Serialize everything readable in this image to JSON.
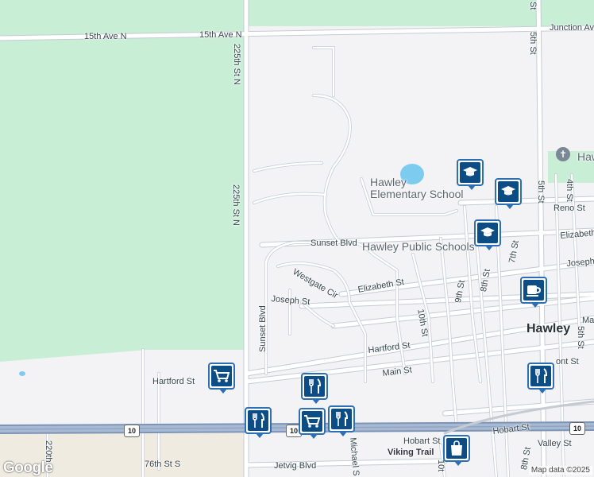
{
  "map": {
    "colors": {
      "park": "#c8eed6",
      "land": "#f3f3f5",
      "farm": "#f0ebe0",
      "road": "#ffffff",
      "road_edge": "#c5cbd3",
      "highway": "#8fa5c2",
      "water": "#7ecbf0"
    },
    "labels": {
      "ave15_west": "15th Ave N",
      "ave15_east": "15th Ave N",
      "st225_top": "225th St N",
      "st225_mid": "225th St N",
      "st5_top": "5th St",
      "junction": "Junction Ave",
      "hawley_church": "Hawl",
      "elementary": "Hawley Elementary School",
      "public_schools": "Hawley Public Schools",
      "sunset_blvd_h": "Sunset Blvd",
      "sunset_blvd_v": "Sunset Blvd",
      "westgate": "Westgate Cir",
      "elizabeth_w": "Elizabeth St",
      "elizabeth_e": "Elizabeth",
      "joseph_w": "Joseph St",
      "joseph_e": "Joseph",
      "reno": "Reno St",
      "st4": "4th St",
      "st5_mid": "5th St",
      "st5_low": "5th St",
      "st7": "7th St",
      "st8": "8th St",
      "st8_low": "8th St",
      "st9": "9th St",
      "st10": "10th St",
      "hawley": "Hawley",
      "ma": "Ma",
      "hartford_w": "Hartford St",
      "hartford_e": "Hartford St",
      "main": "Main St",
      "front": "ont St",
      "hobart_w": "Hobart St",
      "hobart_e": "Hobart St",
      "valley": "Valley St",
      "viking": "Viking Trail",
      "st76": "76th St S",
      "jetvig": "Jetvig Blvd",
      "michael": "Michael S",
      "st220": "220th",
      "st10_low": "10t",
      "hwy10_a": "10",
      "hwy10_b": "10",
      "hwy10_c": "10"
    },
    "pois": [
      {
        "type": "school",
        "icon": "graduation-cap-icon"
      },
      {
        "type": "school",
        "icon": "graduation-cap-icon"
      },
      {
        "type": "school",
        "icon": "graduation-cap-icon"
      },
      {
        "type": "cafe",
        "icon": "coffee-cup-icon"
      },
      {
        "type": "grocery",
        "icon": "shopping-cart-icon"
      },
      {
        "type": "restaurant",
        "icon": "fork-knife-icon"
      },
      {
        "type": "restaurant",
        "icon": "fork-knife-icon"
      },
      {
        "type": "grocery",
        "icon": "shopping-cart-icon"
      },
      {
        "type": "restaurant",
        "icon": "fork-knife-icon"
      },
      {
        "type": "restaurant",
        "icon": "fork-knife-icon"
      },
      {
        "type": "shopping",
        "icon": "shopping-bag-icon"
      }
    ],
    "google_logo": "Google",
    "attribution": "Map data ©2025"
  }
}
